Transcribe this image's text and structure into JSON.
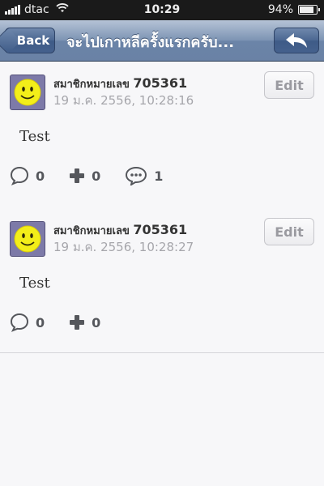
{
  "status": {
    "carrier": "dtac",
    "time": "10:29",
    "battery": "94%",
    "battery_level": 0.94
  },
  "nav": {
    "back_label": "Back",
    "title": "จะไปเกาหลีครั้งแรกครับ..."
  },
  "posts": [
    {
      "author_prefix": "สมาชิกหมายเลข",
      "author_number": "705361",
      "date": "19 ม.ค. 2556, 10:28:16",
      "edit_label": "Edit",
      "text": "Test",
      "comments": "0",
      "plus": "0",
      "replies": "1"
    },
    {
      "author_prefix": "สมาชิกหมายเลข",
      "author_number": "705361",
      "date": "19 ม.ค. 2556, 10:28:27",
      "edit_label": "Edit",
      "text": "Test",
      "comments": "0",
      "plus": "0"
    }
  ]
}
